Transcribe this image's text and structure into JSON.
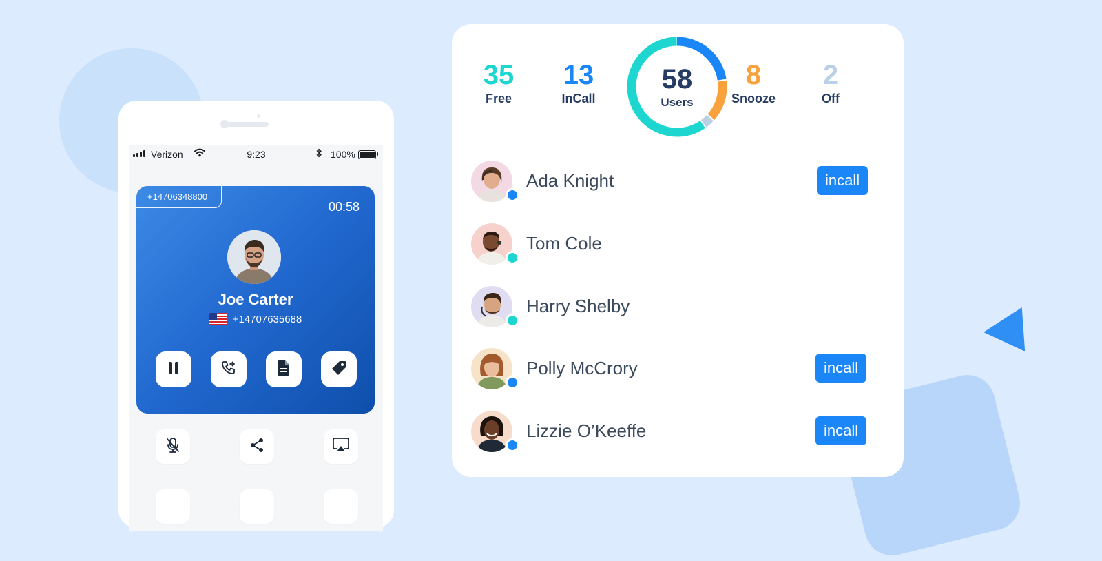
{
  "colors": {
    "background": "#dcebfd",
    "accent_blue": "#1b86f7",
    "free_teal": "#1ed6d0",
    "snooze_orange": "#f9a23b",
    "off_gray": "#b9d0e6",
    "text_dark": "#263c63"
  },
  "phone": {
    "status_bar": {
      "carrier": "Verizon",
      "time": "9:23",
      "battery": "100%"
    },
    "call": {
      "line_number": "+14706348800",
      "timer": "00:58",
      "contact_name": "Joe Carter",
      "contact_number": "+14707635688",
      "actions": [
        {
          "name": "hold",
          "icon": "pause-icon"
        },
        {
          "name": "transfer",
          "icon": "phone-transfer-icon"
        },
        {
          "name": "notes",
          "icon": "document-icon"
        },
        {
          "name": "tag",
          "icon": "tag-icon"
        }
      ]
    },
    "tools": [
      {
        "name": "mute",
        "icon": "mic-off-icon"
      },
      {
        "name": "share",
        "icon": "share-icon"
      },
      {
        "name": "airplay",
        "icon": "airplay-icon"
      }
    ]
  },
  "dashboard": {
    "stats": [
      {
        "key": "free",
        "value": "35",
        "label": "Free",
        "color": "#1ed6d0"
      },
      {
        "key": "incall",
        "value": "13",
        "label": "InCall",
        "color": "#1b86f7"
      },
      {
        "key": "snooze",
        "value": "8",
        "label": "Snooze",
        "color": "#f9a23b"
      },
      {
        "key": "off",
        "value": "2",
        "label": "Off",
        "color": "#b9d0e6"
      }
    ],
    "total": {
      "value": "58",
      "label": "Users"
    },
    "users": [
      {
        "name": "Ada Knight",
        "status_color": "#1b86f7",
        "badge": "incall"
      },
      {
        "name": "Tom Cole",
        "status_color": "#1ed6d0",
        "badge": ""
      },
      {
        "name": "Harry Shelby",
        "status_color": "#1ed6d0",
        "badge": ""
      },
      {
        "name": "Polly McCrory",
        "status_color": "#1b86f7",
        "badge": "incall"
      },
      {
        "name": "Lizzie O’Keeffe",
        "status_color": "#1b86f7",
        "badge": "incall"
      }
    ]
  }
}
